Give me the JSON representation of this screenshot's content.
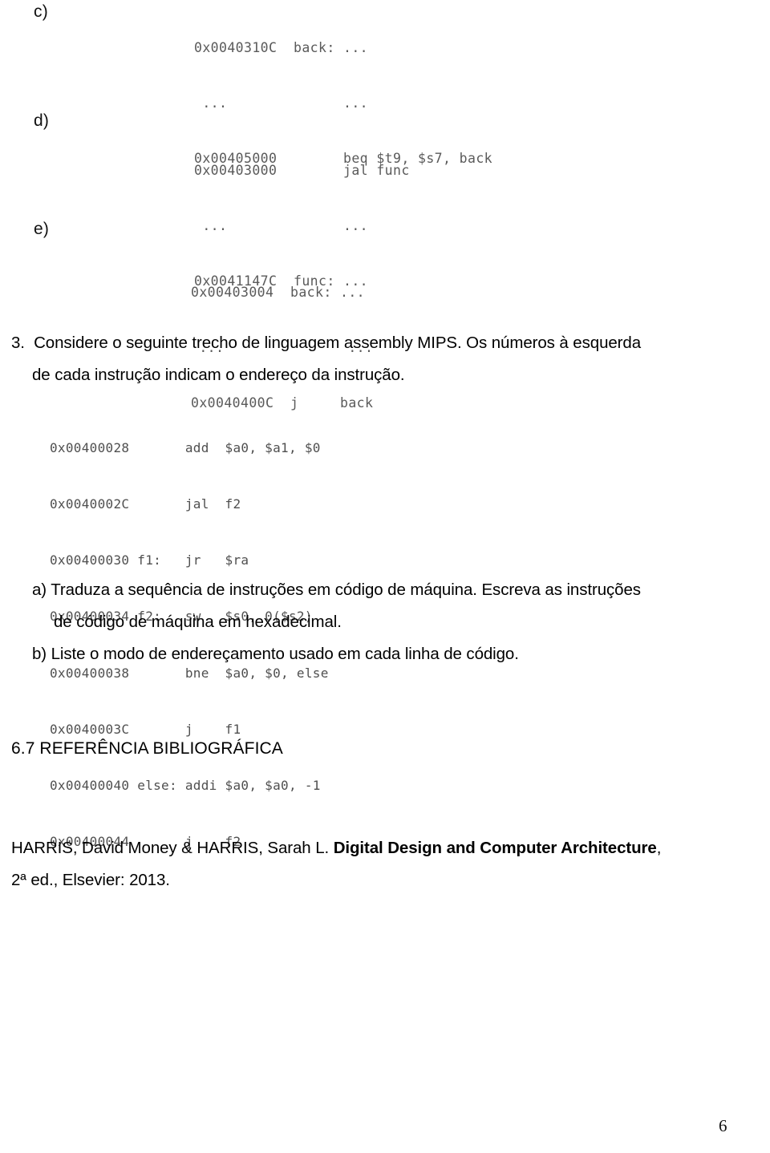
{
  "document": {
    "page_number": "6",
    "language": "pt-BR"
  },
  "exercise_items": [
    {
      "letter": "c)",
      "code_lines": [
        "0x0040310C  back: ...",
        " ...              ...",
        "0x00405000        beq $t9, $s7, back"
      ]
    },
    {
      "letter": "d)",
      "code_lines": [
        "0x00403000        jal func",
        " ...              ...",
        "0x0041147C  func: ..."
      ]
    },
    {
      "letter": "e)",
      "code_lines": [
        "0x00403004  back: ...",
        " ...               ...",
        "0x0040400C  j     back"
      ]
    }
  ],
  "question3": {
    "number": "3.",
    "statement_lines": [
      "3.  Considere o seguinte trecho de linguagem assembly MIPS. Os números à esquerda",
      "de cada instrução indicam o endereço da instrução."
    ],
    "assembly_listing": [
      "0x00400028       add  $a0, $a1, $0",
      "0x0040002C       jal  f2",
      "0x00400030 f1:   jr   $ra",
      "0x00400034 f2:   sw   $s0, 0($s2)",
      "0x00400038       bne  $a0, $0, else",
      "0x0040003C       j    f1",
      "0x00400040 else: addi $a0, $a0, -1",
      "0x00400044       j    f2"
    ],
    "sub_questions": [
      {
        "letter": "a)",
        "lines": [
          "a) Traduza a sequência de instruções em código de máquina. Escreva as instruções",
          "de código de máquina em hexadecimal."
        ]
      },
      {
        "letter": "b)",
        "lines": [
          "b) Liste o modo de endereçamento usado em cada linha de código."
        ]
      }
    ]
  },
  "references_section": {
    "heading": "6.7 REFERÊNCIA BIBLIOGRÁFICA",
    "entry": {
      "authors": "HARRIS, David Money & HARRIS, Sarah L. ",
      "title": "Digital Design and Computer Architecture",
      "tail": ",",
      "edition_line": "2ª ed., Elsevier: 2013."
    }
  }
}
